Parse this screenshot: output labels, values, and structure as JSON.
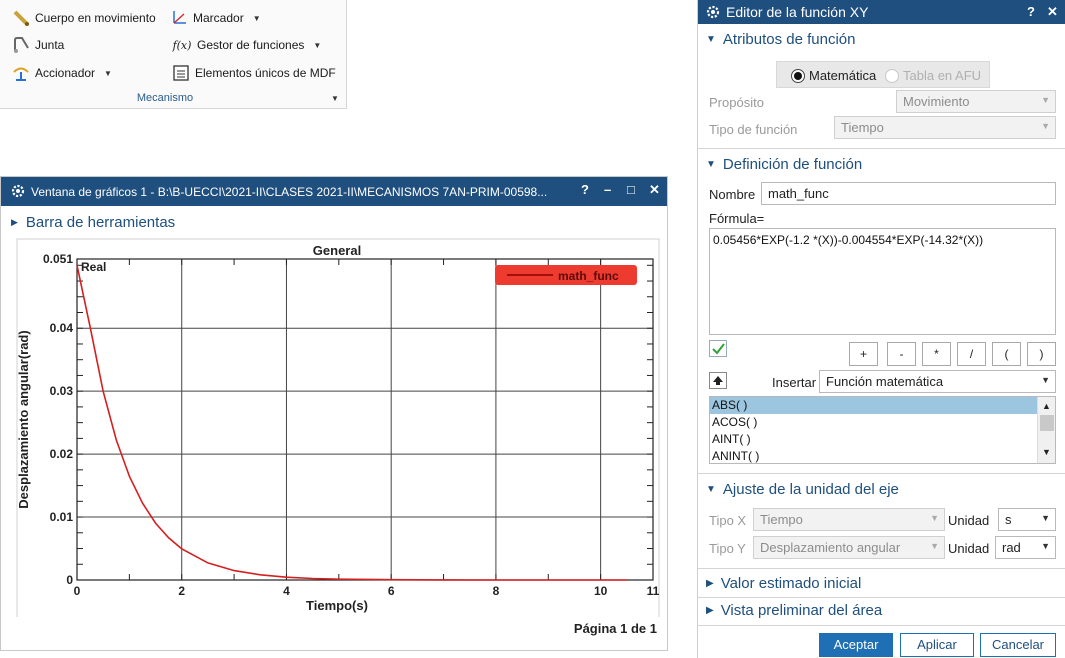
{
  "ribbon": {
    "items": [
      {
        "label": "Cuerpo en movimiento",
        "icon": "motion-body-icon",
        "dropdown": false
      },
      {
        "label": "Marcador",
        "icon": "marker-icon",
        "dropdown": true
      },
      {
        "label": "Junta",
        "icon": "joint-icon",
        "dropdown": false
      },
      {
        "label": "Gestor de funciones",
        "icon": "function-manager-icon",
        "icon_text": "f(x)",
        "dropdown": true
      },
      {
        "label": "Accionador",
        "icon": "actuator-icon",
        "dropdown": true
      },
      {
        "label": "Elementos únicos de MDF",
        "icon": "mdf-elements-icon",
        "dropdown": false
      }
    ],
    "group_label": "Mecanismo"
  },
  "graph_window": {
    "title": "Ventana de gráficos 1 - B:\\B-UECCI\\2021-II\\CLASES 2021-II\\MECANISMOS 7AN-PRIM-00598...",
    "help": "?",
    "minimize": "–",
    "maximize": "□",
    "close": "✕",
    "toolbar_label": "Barra de herramientas",
    "page_label": "Página 1 de 1"
  },
  "chart_data": {
    "type": "line",
    "title": "General",
    "xlabel": "Tiempo(s)",
    "ylabel": "Desplazamiento angular(rad)",
    "corner_label": "Real",
    "xlim": [
      0,
      11
    ],
    "ylim": [
      0,
      0.051
    ],
    "xticks": [
      0,
      2,
      4,
      6,
      8,
      10,
      11
    ],
    "yticks": [
      0,
      0.01,
      0.02,
      0.03,
      0.04,
      0.051
    ],
    "ytick_labels": [
      "0",
      "0.01",
      "0.02",
      "0.03",
      "0.04",
      "0.051"
    ],
    "grid": true,
    "legend_position": "top-right",
    "series": [
      {
        "name": "math_func",
        "color": "#d42020",
        "x": [
          0,
          0.25,
          0.5,
          0.75,
          1,
          1.25,
          1.5,
          1.75,
          2,
          2.5,
          3,
          3.5,
          4,
          4.5,
          5,
          6,
          7,
          8,
          9,
          10,
          10.5
        ],
        "y": [
          0.05,
          0.04023,
          0.02995,
          0.02224,
          0.01648,
          0.01221,
          0.00904,
          0.0067,
          0.00496,
          0.00272,
          0.00149,
          0.00082,
          0.00045,
          0.000246,
          0.000135,
          4e-05,
          1.2e-05,
          3.7e-06,
          1.1e-06,
          3.4e-07,
          1.8e-07
        ]
      }
    ]
  },
  "dialog": {
    "title": "Editor de la función XY",
    "help": "?",
    "close": "✕",
    "sections": {
      "attributes": "Atributos de función",
      "definition": "Definición de función",
      "axis_units": "Ajuste de la unidad del eje",
      "initial_guess": "Valor estimado inicial",
      "area_preview": "Vista preliminar del área"
    },
    "radio": {
      "math": "Matemática",
      "afu": "Tabla en AFU"
    },
    "purpose_label": "Propósito",
    "purpose_value": "Movimiento",
    "func_type_label": "Tipo de función",
    "func_type_value": "Tiempo",
    "name_label": "Nombre",
    "name_value": "math_func",
    "formula_label": "Fórmula=",
    "formula_value": "0.05456*EXP(-1.2 *(X))-0.004554*EXP(-14.32*(X))",
    "operators": [
      "+",
      "-",
      "*",
      "/",
      "(",
      ")"
    ],
    "insert_label": "Insertar",
    "insert_value": "Función matemática",
    "functions": [
      "ABS( )",
      "ACOS( )",
      "AINT( )",
      "ANINT( )"
    ],
    "x_type_label": "Tipo X",
    "x_type_value": "Tiempo",
    "x_unit_label": "Unidad",
    "x_unit_value": "s",
    "y_type_label": "Tipo Y",
    "y_type_value": "Desplazamiento angular",
    "y_unit_label": "Unidad",
    "y_unit_value": "rad",
    "buttons": {
      "ok": "Aceptar",
      "apply": "Aplicar",
      "cancel": "Cancelar"
    },
    "accent_color": "#1e4f7e",
    "primary_button_color": "#1e6fb3"
  }
}
